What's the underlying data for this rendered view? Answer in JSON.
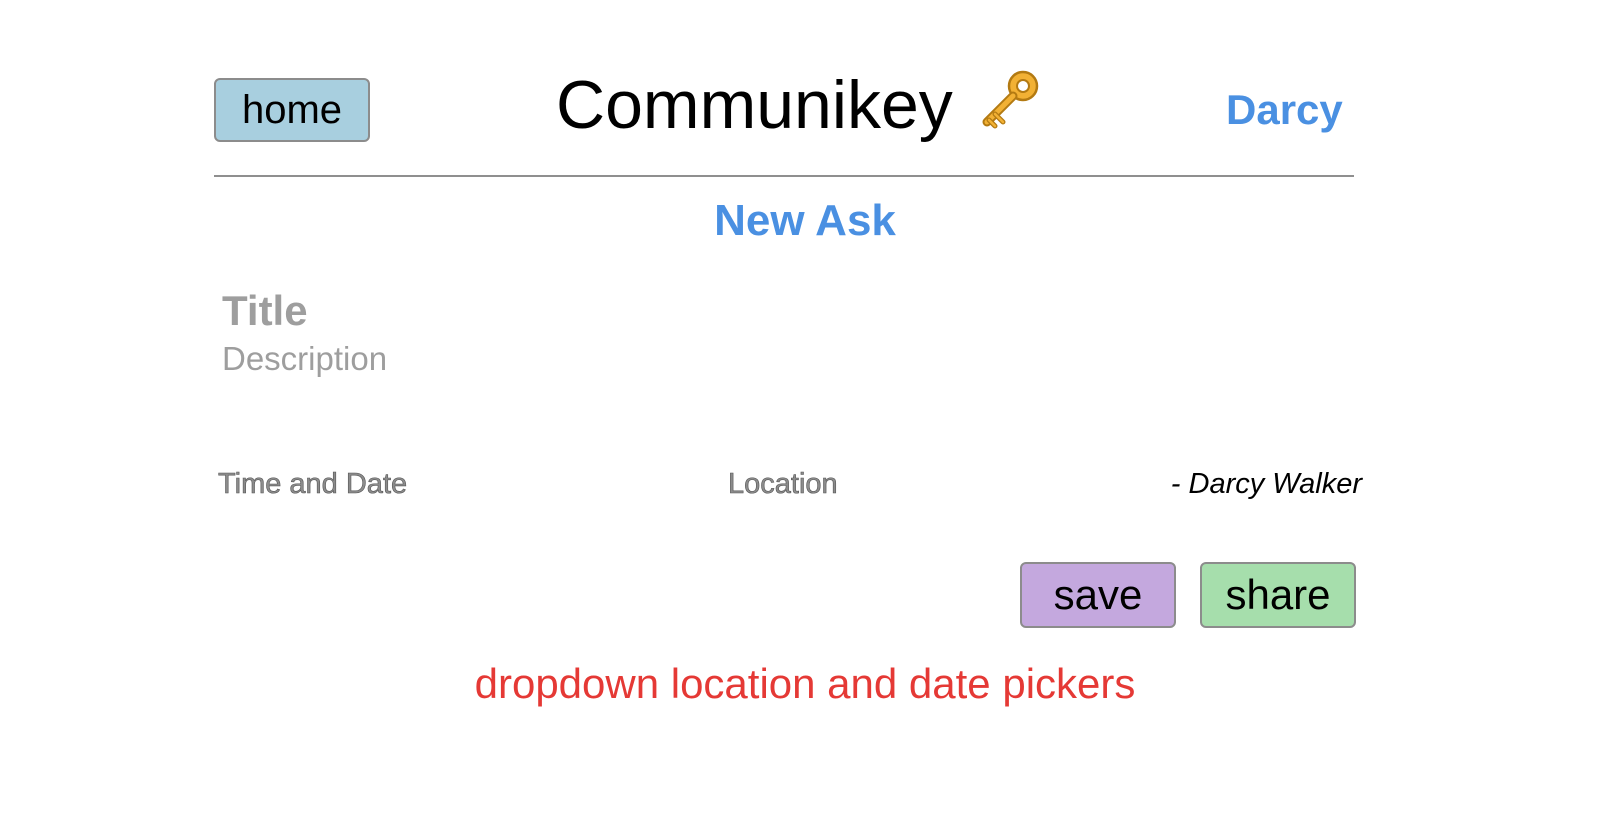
{
  "header": {
    "home_label": "home",
    "app_title": "Communikey",
    "title_icon": "key-icon",
    "user_name": "Darcy"
  },
  "form": {
    "heading": "New Ask",
    "title_placeholder": "Title",
    "description_placeholder": "Description",
    "time_date_label": "Time and Date",
    "location_label": "Location",
    "author_signature": "- Darcy Walker"
  },
  "actions": {
    "save_label": "save",
    "share_label": "share"
  },
  "annotation": {
    "note": "dropdown location and date pickers"
  },
  "colors": {
    "accent_blue": "#4a90e2",
    "home_button": "#a8cfdf",
    "save_button": "#c4a8de",
    "share_button": "#a6deac",
    "annotation_red": "#e53935"
  }
}
